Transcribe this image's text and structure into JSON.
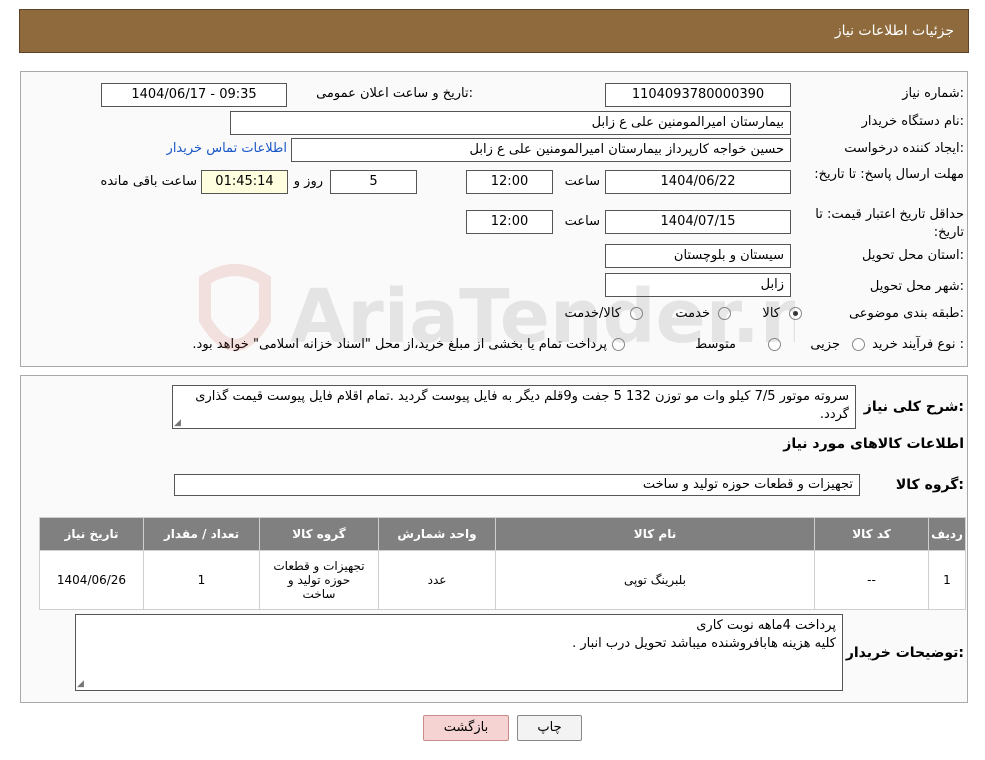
{
  "header": {
    "title": "جزئیات اطلاعات نیاز"
  },
  "form": {
    "need_number_label": "شماره نیاز:",
    "need_number": "1104093780000390",
    "announce_label": "تاریخ و ساعت اعلان عمومی:",
    "announce_value": "1404/06/17 - 09:35",
    "buyer_org_label": "نام دستگاه خریدار:",
    "buyer_org": "بیمارستان امیرالمومنین علی  ع  زابل",
    "creator_label": "ایجاد کننده درخواست:",
    "creator": "حسین خواجه کارپرداز بیمارستان امیرالمومنین علی  ع  زابل",
    "contact_link": "اطلاعات تماس خریدار",
    "deadline_label": "مهلت ارسال پاسخ: تا تاریخ:",
    "deadline_date": "1404/06/22",
    "time_label": "ساعت",
    "deadline_time": "12:00",
    "days": "5",
    "days_label": "روز و",
    "remaining_time": "01:45:14",
    "remaining_label": "ساعت باقی مانده",
    "validity_label": "حداقل تاریخ اعتبار قیمت: تا تاریخ:",
    "validity_date": "1404/07/15",
    "validity_time": "12:00",
    "province_label": "استان محل تحویل:",
    "province": "سیستان و بلوچستان",
    "city_label": "شهر محل تحویل:",
    "city": "زابل",
    "category_label": "طبقه بندی موضوعی:",
    "category_options": [
      "کالا",
      "خدمت",
      "کالا/خدمت"
    ],
    "category_selected": "کالا",
    "process_label": "نوع فرآیند خرید :",
    "process_options": [
      "جزیی",
      "متوسط"
    ],
    "process_note": "پرداخت تمام یا بخشی از مبلغ خرید،از محل \"اسناد خزانه اسلامی\" خواهد بود."
  },
  "description": {
    "label": "شرح کلی نیاز:",
    "text": "سروته موتور 7/5 کیلو وات مو توزن 132  5 جفت و9قلم دیگر به فایل پیوست گردید  .تمام اقلام فایل پیوست قیمت گذاری گردد."
  },
  "goods": {
    "section_title": "اطلاعات کالاهای مورد نیاز",
    "group_label": "گروه کالا:",
    "group_value": "تجهیزات و قطعات حوزه تولید و ساخت"
  },
  "table": {
    "headers": [
      "ردیف",
      "کد کالا",
      "نام کالا",
      "واحد شمارش",
      "گروه کالا",
      "تعداد / مقدار",
      "تاریخ نیاز"
    ],
    "rows": [
      {
        "row": "1",
        "code": "--",
        "name": "بلبرینگ توپی",
        "unit": "عدد",
        "group": "تجهیزات و قطعات حوزه تولید و ساخت",
        "qty": "1",
        "date": "1404/06/26"
      }
    ]
  },
  "buyer_notes": {
    "label": "توضیحات خریدار:",
    "line1": "پرداخت 4ماهه نوبت کاری",
    "line2": "کلیه هزینه هابافروشنده میباشد تحویل درب انبار ."
  },
  "buttons": {
    "print": "چاپ",
    "back": "بازگشت"
  },
  "watermark": {
    "text": "AriaTender.neT"
  },
  "colors": {
    "header_bg": "#8e6a3c",
    "table_header": "#808080",
    "link": "#1a57c7",
    "back_button": "#f6d3d3"
  }
}
